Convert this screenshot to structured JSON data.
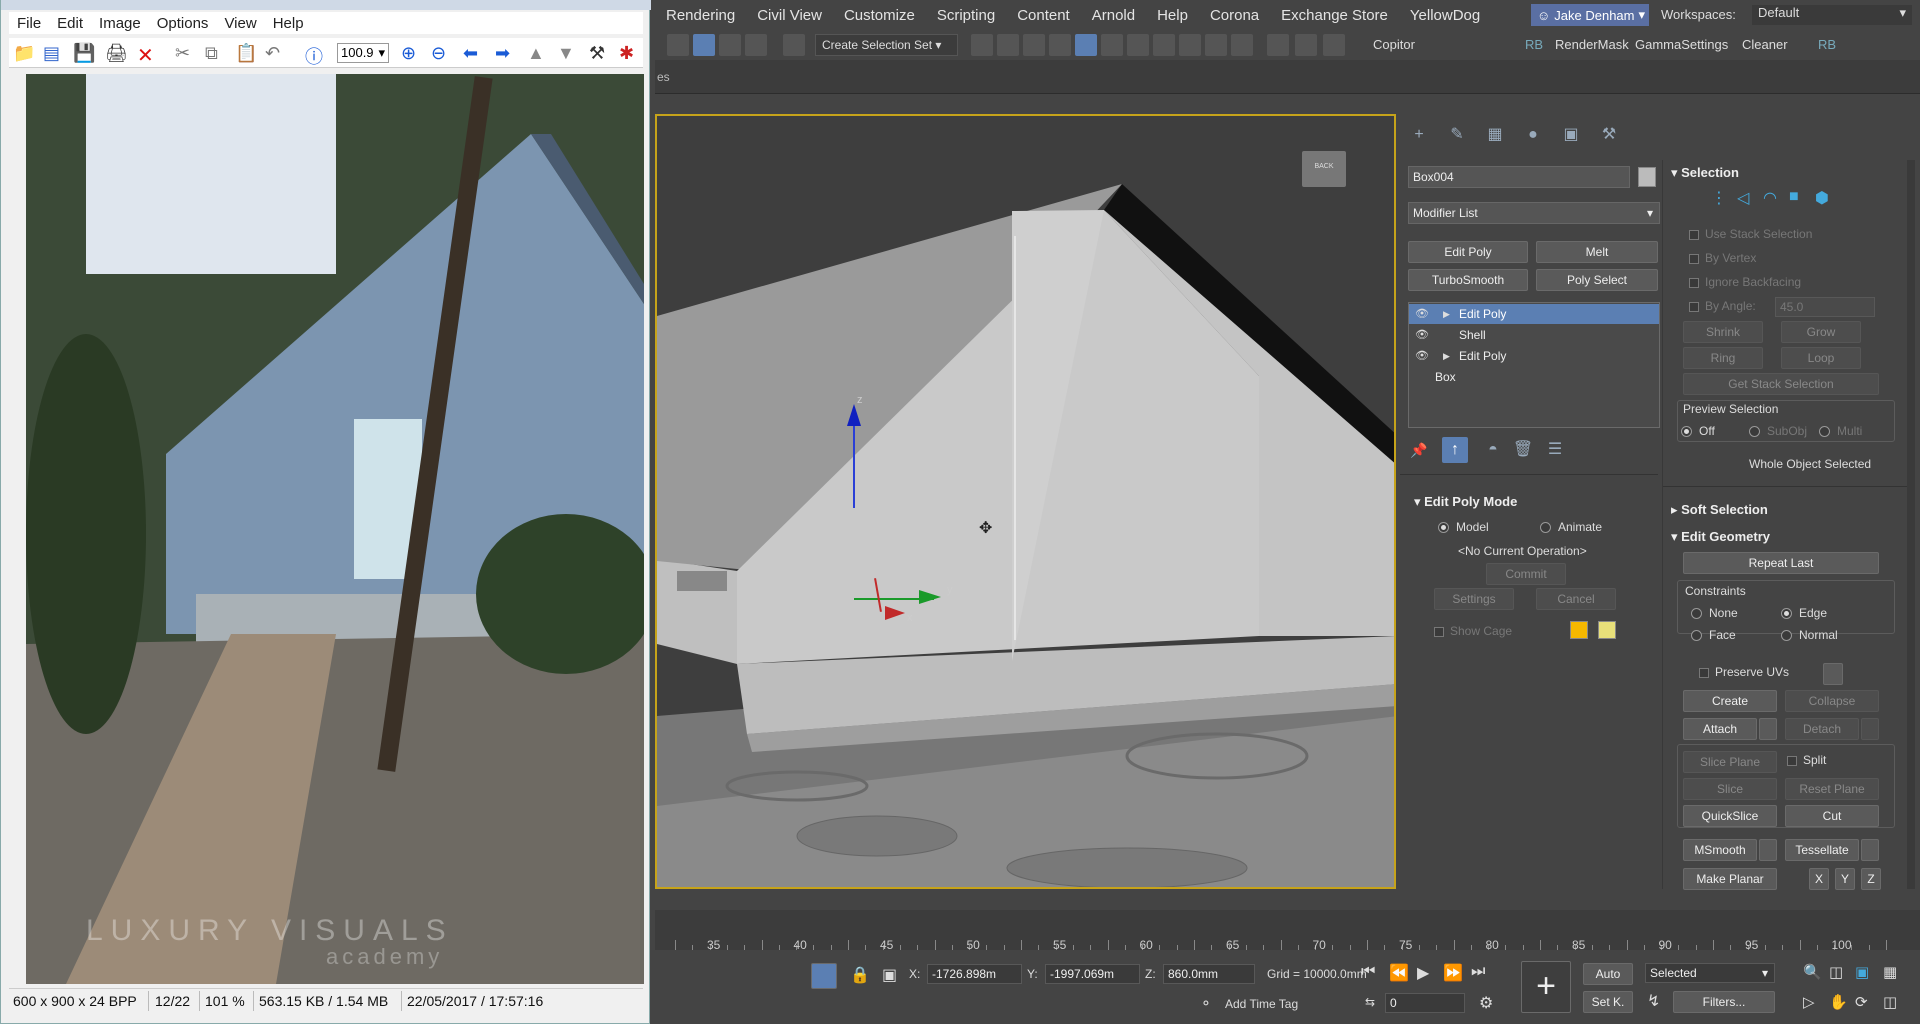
{
  "viewer": {
    "menu": [
      "File",
      "Edit",
      "Image",
      "Options",
      "View",
      "Help"
    ],
    "zoom_value": "100.9",
    "status": {
      "dimensions": "600 x 900 x 24 BPP",
      "index": "12/22",
      "zoom": "101 %",
      "size": "563.15 KB / 1.54 MB",
      "datetime": "22/05/2017 / 17:57:16"
    },
    "watermark_line1": "LUXURY VISUALS",
    "watermark_line2": "academy"
  },
  "max": {
    "menu": [
      "Rendering",
      "Civil View",
      "Customize",
      "Scripting",
      "Content",
      "Arnold",
      "Help",
      "Corona",
      "Exchange Store",
      "YellowDog"
    ],
    "user": "Jake Denham",
    "workspaces_label": "Workspaces:",
    "workspace_value": "Default",
    "toolbar": {
      "selection_set": "Create Selection Set",
      "copitor": "Copitor",
      "rb1": "RB",
      "rendermask": "RenderMask",
      "gamma": "GammaSettings",
      "cleaner": "Cleaner",
      "rb2": "RB"
    },
    "viewport_label": "es",
    "object_name": "Box004",
    "modifier_list": "Modifier List",
    "mod_buttons": [
      "Edit Poly",
      "Melt",
      "TurboSmooth",
      "Poly Select"
    ],
    "stack": [
      {
        "label": "Edit Poly",
        "selected": true,
        "arrow": true
      },
      {
        "label": "Shell",
        "selected": false,
        "arrow": false
      },
      {
        "label": "Edit Poly",
        "selected": false,
        "arrow": true
      },
      {
        "label": "Box",
        "selected": false,
        "arrow": false
      }
    ],
    "edit_poly_mode": {
      "title": "Edit Poly Mode",
      "model": "Model",
      "animate": "Animate",
      "no_op": "<No Current Operation>",
      "commit": "Commit",
      "settings": "Settings",
      "cancel": "Cancel",
      "show_cage": "Show Cage",
      "cage_color1": "#f5b800",
      "cage_color2": "#e8e07a"
    },
    "selection": {
      "title": "Selection",
      "use_stack": "Use Stack Selection",
      "by_vertex": "By Vertex",
      "ignore_backfacing": "Ignore Backfacing",
      "by_angle": "By Angle:",
      "angle_value": "45.0",
      "shrink": "Shrink",
      "grow": "Grow",
      "ring": "Ring",
      "loop": "Loop",
      "get_stack": "Get Stack Selection",
      "preview": "Preview Selection",
      "off": "Off",
      "subobj": "SubObj",
      "multi": "Multi",
      "whole": "Whole Object Selected"
    },
    "soft_selection": "Soft Selection",
    "edit_geometry": {
      "title": "Edit Geometry",
      "repeat_last": "Repeat Last",
      "constraints": "Constraints",
      "none": "None",
      "edge": "Edge",
      "face": "Face",
      "normal": "Normal",
      "preserve_uvs": "Preserve UVs",
      "create": "Create",
      "collapse": "Collapse",
      "attach": "Attach",
      "detach": "Detach",
      "slice_plane": "Slice Plane",
      "split": "Split",
      "slice": "Slice",
      "reset_plane": "Reset Plane",
      "quickslice": "QuickSlice",
      "cut": "Cut",
      "msmooth": "MSmooth",
      "tessellate": "Tessellate",
      "make_planar": "Make Planar",
      "x": "X",
      "y": "Y",
      "z": "Z"
    },
    "gizmo": {
      "x": "x",
      "y": "y",
      "z": "z"
    },
    "viewcube": "BACK",
    "timeline_numbers": [
      "35",
      "40",
      "45",
      "50",
      "55",
      "60",
      "65",
      "70",
      "75",
      "80",
      "85",
      "90",
      "95",
      "100"
    ],
    "coords": {
      "x_label": "X:",
      "x": "-1726.898m",
      "y_label": "Y:",
      "y": "-1997.069m",
      "z_label": "Z:",
      "z": "860.0mm",
      "grid": "Grid = 10000.0mm"
    },
    "add_time_tag": "Add Time Tag",
    "auto": "Auto",
    "set_key": "Set K.",
    "selected": "Selected",
    "filters": "Filters...",
    "frame": "0"
  }
}
